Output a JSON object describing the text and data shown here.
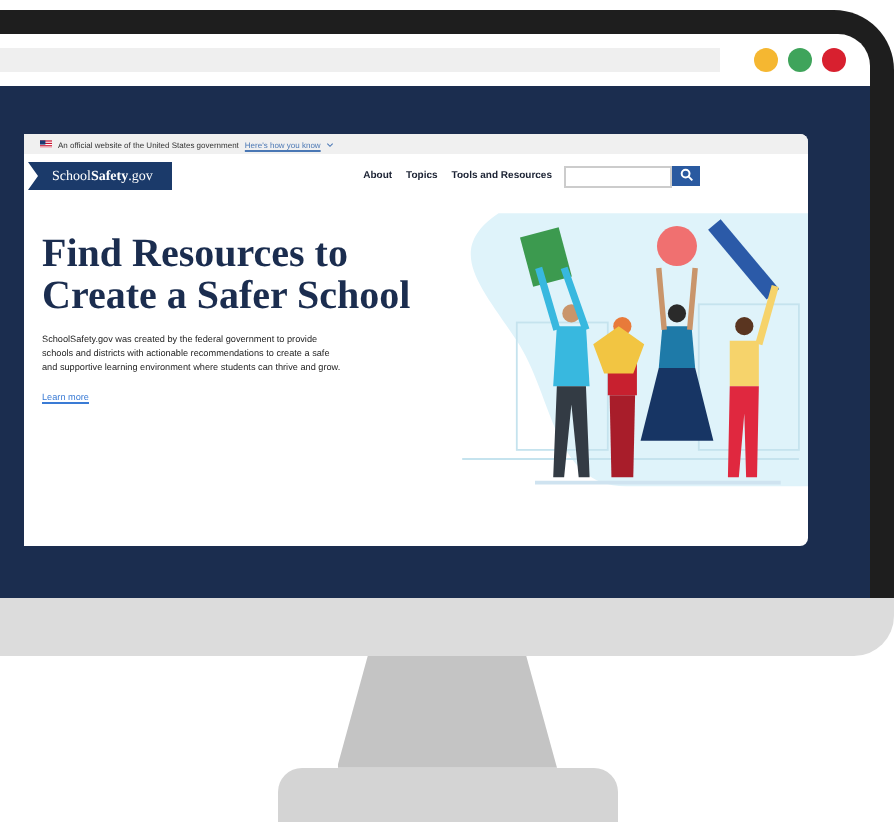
{
  "browser": {
    "window_controls": [
      {
        "color": "#f5b731"
      },
      {
        "color": "#3fa45b"
      },
      {
        "color": "#d8202f"
      }
    ]
  },
  "website": {
    "gov_banner": {
      "text": "An official website of the United States government",
      "link": "Here's how you know"
    },
    "logo": "School**Safety**.gov",
    "nav": [
      "About",
      "Topics",
      "Tools and Resources"
    ],
    "hero": {
      "title": "Find Resources to Create a Safer School",
      "body": "SchoolSafety.gov was created by the federal government to provide schools and districts with actionable recommendations to create a safe and supportive learning environment where students can thrive and grow.",
      "link": "Learn more"
    }
  }
}
